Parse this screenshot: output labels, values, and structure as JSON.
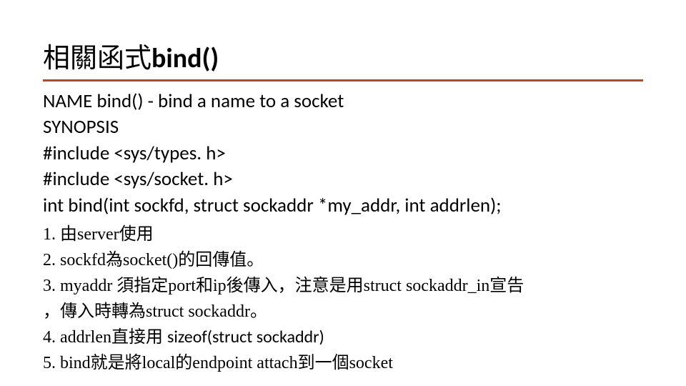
{
  "title": {
    "cjk": "相關函式",
    "bold": "bind()"
  },
  "synopsis": {
    "l1": "NAME bind() - bind a name to a socket",
    "l2": "SYNOPSIS",
    "l3": "#include <sys/types. h>",
    "l4": "#include <sys/socket. h>",
    "l5": "int bind(int sockfd, struct sockaddr *my_addr, int addrlen);"
  },
  "notes": {
    "n1": "1. 由server使用",
    "n2": "2. sockfd為socket()的回傳值。",
    "n3": "3. myaddr 須指定port和ip後傳入，注意是用struct sockaddr_in宣告",
    "n3b": "，傳入時轉為struct sockaddr。",
    "n4a": "4. addrlen直接用 ",
    "n4b": "sizeof(struct sockaddr)",
    "n5": "5. bind就是將local的endpoint attach到一個socket"
  }
}
